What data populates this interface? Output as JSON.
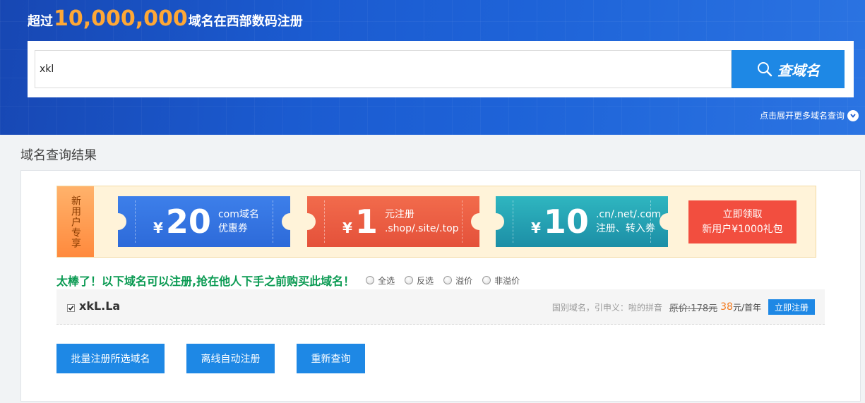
{
  "hero": {
    "title_pre": "超过",
    "title_big": "10,000,000",
    "title_post": "域名在西部数码注册"
  },
  "search": {
    "value": "xkl",
    "button_label": "查域名"
  },
  "more_link": "点击展开更多域名查询",
  "results_title": "域名查询结果",
  "promo": {
    "tag": "新用户专享",
    "coupons": [
      {
        "yen": "¥",
        "amount": "20",
        "line1": "com域名",
        "line2": "优惠券"
      },
      {
        "yen": "¥",
        "amount": "1",
        "line1": "元注册",
        "line2": ".shop/.site/.top"
      },
      {
        "yen": "¥",
        "amount": "10",
        "line1": ".cn/.net/.com",
        "line2": "注册、转入券"
      }
    ],
    "claim_line1": "立即领取",
    "claim_line2": "新用户¥1000礼包"
  },
  "headline": "太棒了！以下域名可以注册,抢在他人下手之前购买此域名！",
  "filters": [
    "全选",
    "反选",
    "溢价",
    "非溢价"
  ],
  "result": {
    "checked": true,
    "domain": "xkL.La",
    "meaning": "国别域名，引申义：啦的拼音",
    "original_price": "原价:178元",
    "price": "38",
    "unit": "元/首年",
    "register_label": "立即注册"
  },
  "actions": [
    "批量注册所选域名",
    "离线自动注册",
    "重新查询"
  ],
  "colors": {
    "accent_blue": "#1e88e5",
    "headline_green": "#0a9a52",
    "price_orange": "#f47b1f",
    "claim_red": "#f24e3f"
  }
}
